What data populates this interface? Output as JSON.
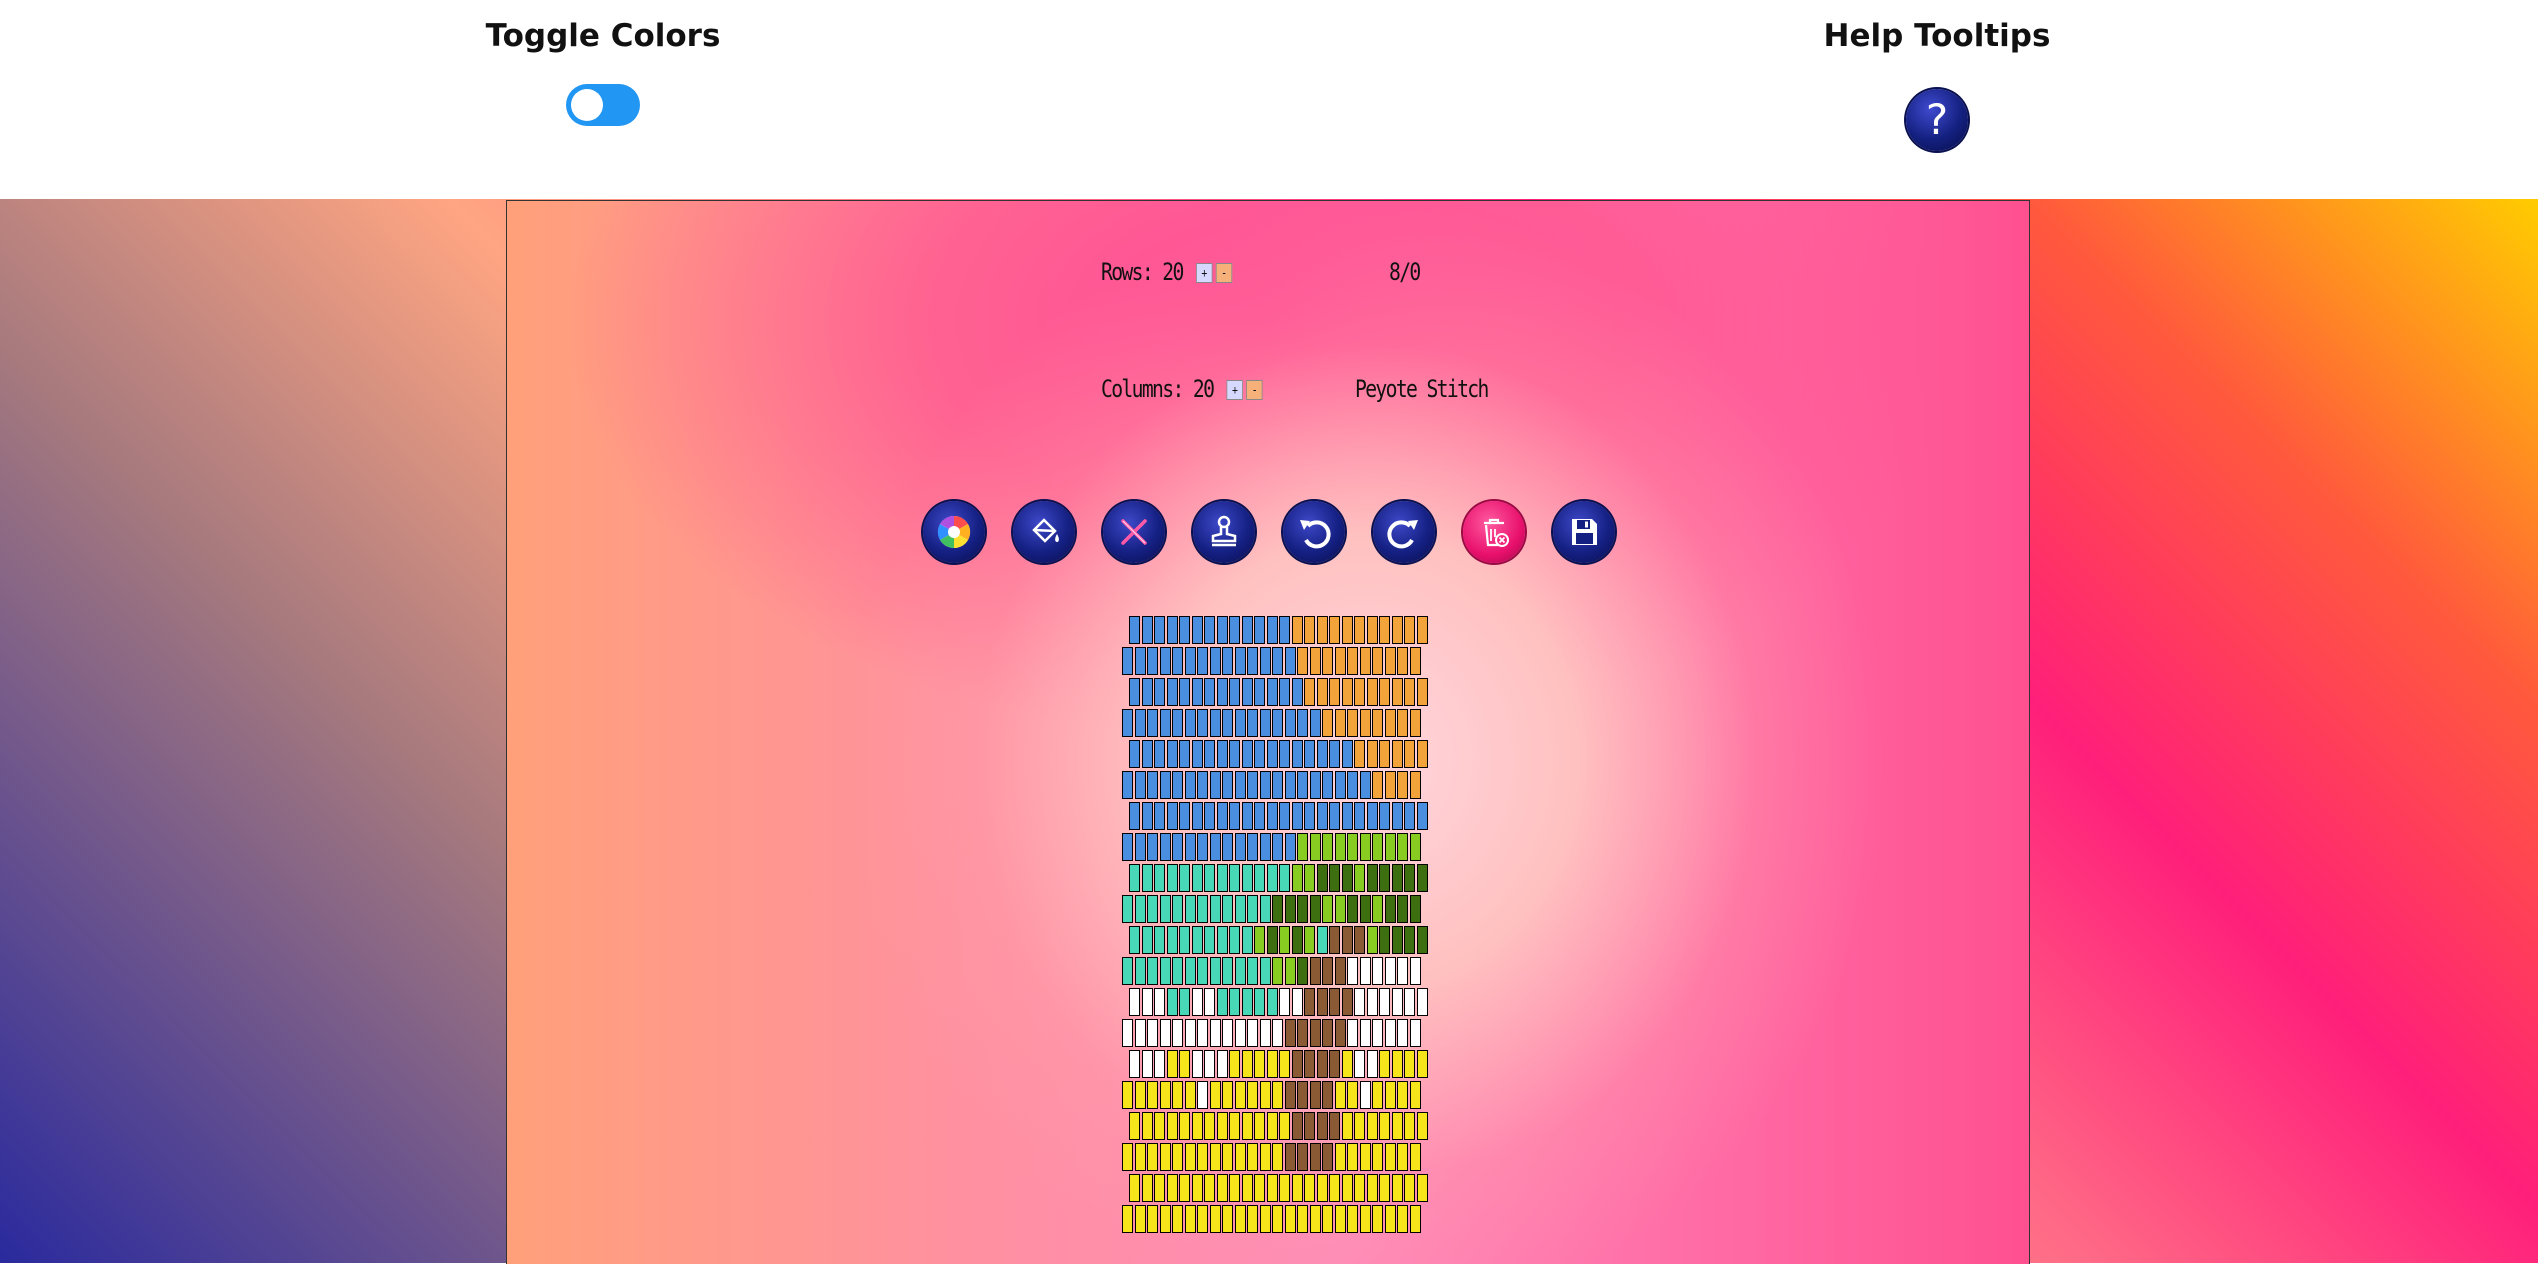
{
  "header": {
    "toggle_colors_label": "Toggle Colors",
    "help_tooltips_label": "Help Tooltips",
    "help_icon_glyph": "?"
  },
  "controls": {
    "rows_label": "Rows: 20",
    "columns_label": "Columns: 20",
    "plus": "+",
    "minus": "-",
    "counter": "8/0",
    "stitch_type": "Peyote Stitch"
  },
  "toolbar": [
    {
      "name": "color-wheel-icon",
      "tool": "color picker"
    },
    {
      "name": "paint-bucket-icon",
      "tool": "fill"
    },
    {
      "name": "eraser-x-icon",
      "tool": "erase"
    },
    {
      "name": "stamp-icon",
      "tool": "stamp"
    },
    {
      "name": "undo-icon",
      "tool": "undo"
    },
    {
      "name": "redo-icon",
      "tool": "redo"
    },
    {
      "name": "trash-icon",
      "tool": "clear"
    },
    {
      "name": "save-icon",
      "tool": "save"
    }
  ],
  "colors": {
    "B": "#4a8ee0",
    "O": "#f2a33a",
    "L": "#88cc22",
    "D": "#3d6e10",
    "T": "#48d8b8",
    "W": "#ffffff",
    "N": "#8a5a34",
    "Y": "#f6e51a",
    "toggle_accent": "#2196f3"
  },
  "pattern": [
    "BBBBBBBBBBBBBOOOOOOOOOOO",
    "BBBBBBBBBBBBBBOOOOOOOOOO",
    "BBBBBBBBBBBBBBOOOOOOOOOO",
    "BBBBBBBBBBBBBBBBOOOOOOOO",
    "BBBBBBBBBBBBBBBBBBOOOOOO",
    "BBBBBBBBBBBBBBBBBBBBOOOO",
    "BBBBBBBBBBBBBBBBBBBBBBBB",
    "BBBBBBBBBBBBBBLLLLLLLLLL",
    "TTTTTTTTTTTTTLLDDDLDDDDD",
    "TTTTTTTTTTTTDDDDLLDDLDDD",
    "TTTTTTTTTTLDLDLTNNNLDDDD",
    "TTTTTTTTTTTTLLDNNNWWWWWW",
    "WWWTTWWTTTTTWWNNNNWWWWWW",
    "WWWWWWWWWWWWWNNNNNWWWWWW",
    "WWWYYWWWYYYYYNNNNYWWYYYY",
    "YYYYYYWYYYYYYNNNNYYWYYYY",
    "YYYYYYYYYYYYYNNNNYYYYYYY",
    "YYYYYYYYYYYYYNNNNYYYYYYY",
    "YYYYYYYYYYYYYYYYYYYYYYYY",
    "YYYYYYYYYYYYYYYYYYYYYYYY"
  ]
}
